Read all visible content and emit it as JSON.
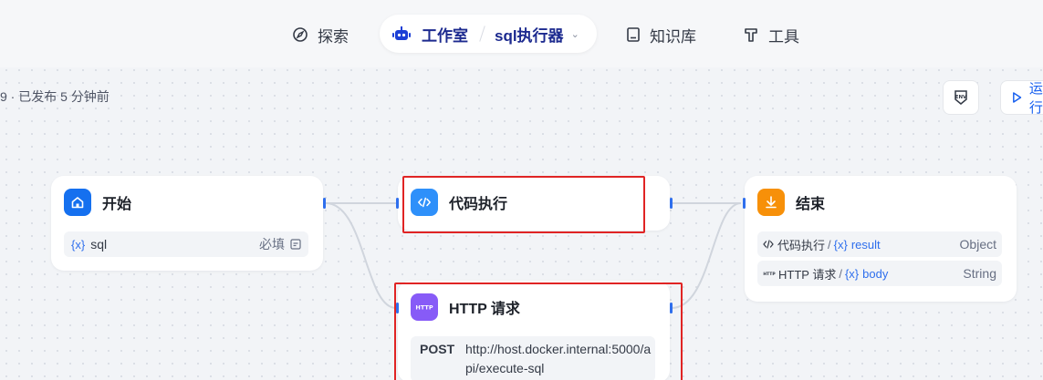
{
  "nav": {
    "explore": "探索",
    "studio": "工作室",
    "app_name": "sql执行器",
    "knowledge": "知识库",
    "tools": "工具"
  },
  "header": {
    "publish_info": "9 · 已发布 5 分钟前",
    "env_label": "ENV",
    "run_label": "运行"
  },
  "nodes": {
    "start": {
      "title": "开始",
      "var_sign": "{x}",
      "var_name": "sql",
      "required": "必填"
    },
    "code": {
      "title": "代码执行"
    },
    "http": {
      "title": "HTTP 请求",
      "method": "POST",
      "url": "http://host.docker.internal:5000/api/execute-sql"
    },
    "end": {
      "title": "结束",
      "outputs": [
        {
          "node": "代码执行",
          "var_sign": "{x}",
          "var": "result",
          "type": "Object"
        },
        {
          "node": "HTTP 请求",
          "var_sign": "{x}",
          "var": "body",
          "type": "String"
        }
      ]
    }
  },
  "colors": {
    "start_icon": "#1570ef",
    "code_icon": "#2e90fa",
    "http_icon": "#875bf7",
    "end_icon": "#f79009",
    "highlight": "#e02424",
    "handle": "#2f6fed"
  },
  "icons": {
    "explore": "compass-icon",
    "studio": "robot-icon",
    "knowledge": "book-icon",
    "tools": "hammer-icon",
    "run": "play-icon"
  }
}
